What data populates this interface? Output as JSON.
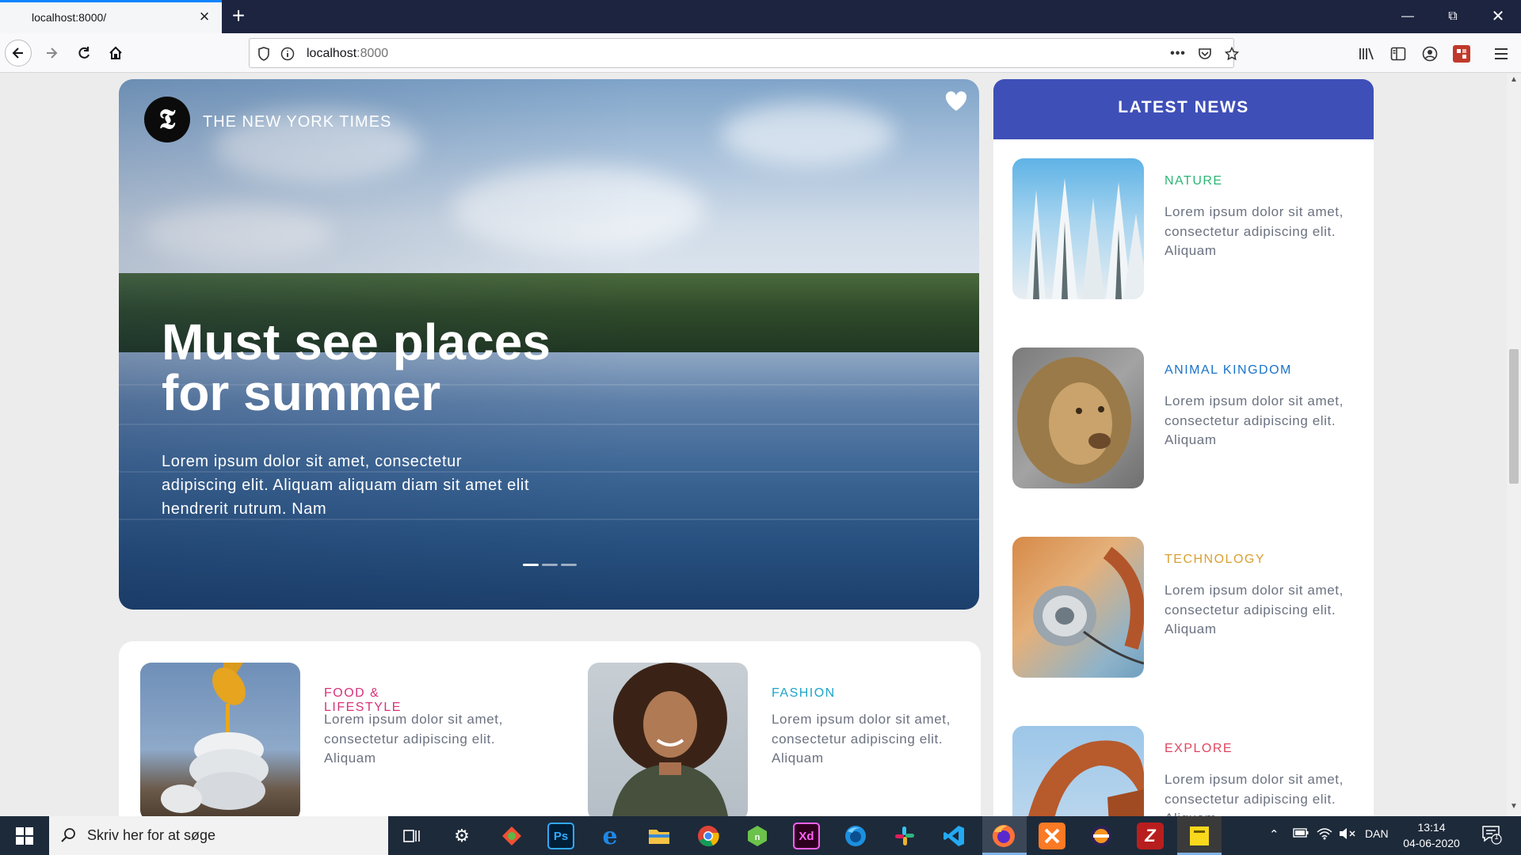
{
  "browser": {
    "tab_title": "localhost:8000/",
    "url_host": "localhost",
    "url_port": ":8000"
  },
  "hero": {
    "source": "THE NEW YORK TIMES",
    "logo_letter": "𝕿",
    "title_line1": "Must see places",
    "title_line2": "for summer",
    "description": "Lorem ipsum dolor sit amet, consectetur adipiscing elit. Aliquam aliquam diam sit amet elit hendrerit rutrum. Nam"
  },
  "bottom_articles": [
    {
      "category": "FOOD & LIFESTYLE",
      "color": "#d6337a",
      "text": "Lorem ipsum dolor sit amet, consectetur adipiscing elit. Aliquam"
    },
    {
      "category": "FASHION",
      "color": "#1ea4c8",
      "text": "Lorem ipsum dolor sit amet, consectetur adipiscing elit. Aliquam"
    }
  ],
  "latest_news": {
    "title": "LATEST NEWS",
    "header_color": "#3f4fb8",
    "items": [
      {
        "category": "NATURE",
        "color": "#2bb673",
        "text": "Lorem ipsum dolor sit amet, consectetur adipiscing elit. Aliquam"
      },
      {
        "category": "ANIMAL KINGDOM",
        "color": "#1a73c9",
        "text": "Lorem ipsum dolor sit amet, consectetur adipiscing elit. Aliquam"
      },
      {
        "category": "TECHNOLOGY",
        "color": "#d9a032",
        "text": "Lorem ipsum dolor sit amet, consectetur adipiscing elit. Aliquam"
      },
      {
        "category": "EXPLORE",
        "color": "#e0465f",
        "text": "Lorem ipsum dolor sit amet, consectetur adipiscing elit. Aliquam"
      }
    ]
  },
  "taskbar": {
    "search_placeholder": "Skriv her for at søge",
    "language": "DAN",
    "time": "13:14",
    "date": "04-06-2020",
    "notification_count": "1"
  }
}
